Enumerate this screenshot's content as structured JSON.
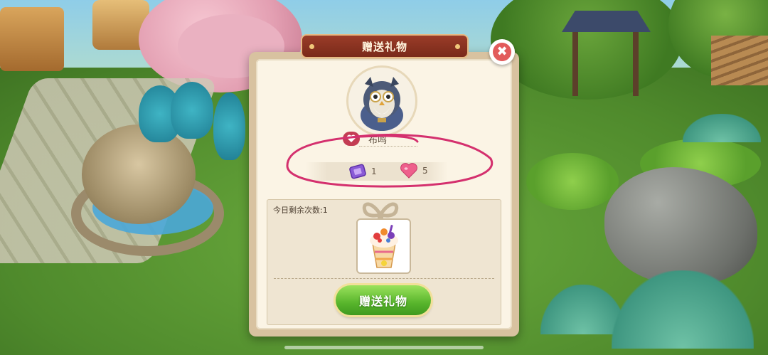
{
  "dialog": {
    "title": "赠送礼物",
    "close_glyph": "✖",
    "npc": {
      "name": "布鸣",
      "avatar": "owl-professor"
    },
    "stats": [
      {
        "icon": "purple-ticket-icon",
        "value": "1"
      },
      {
        "icon": "pink-heart-icon",
        "value": "5"
      }
    ],
    "gift_panel": {
      "remaining_label": "今日剩余次数:1",
      "selected_item": "fruit-parfait"
    },
    "send_button_label": "赠送礼物"
  },
  "colors": {
    "ribbon": "#8a3322",
    "send_button": "#58b52c",
    "highlight_stroke": "#d4306e",
    "close_button": "#e25b5b"
  }
}
